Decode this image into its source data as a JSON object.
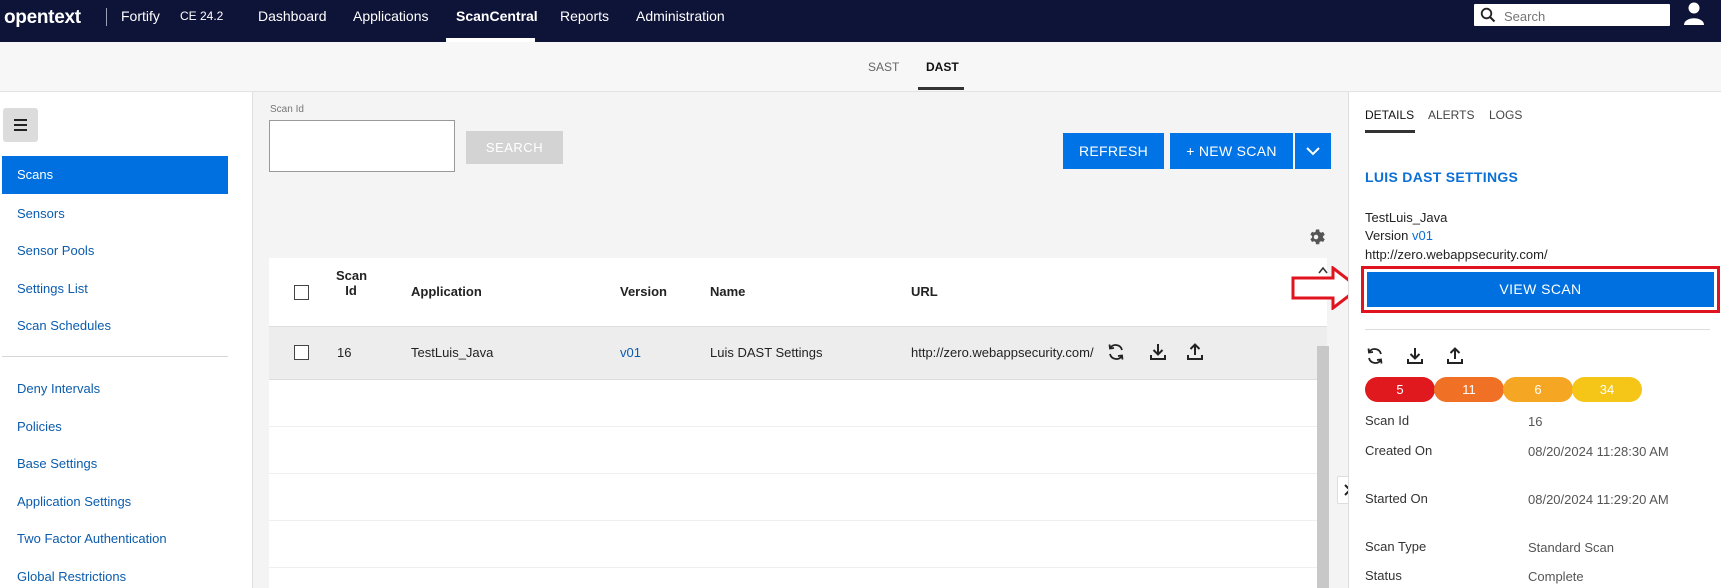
{
  "topbar": {
    "brand": "opentext",
    "product": "Fortify",
    "version": "CE 24.2",
    "nav": [
      "Dashboard",
      "Applications",
      "ScanCentral",
      "Reports",
      "Administration"
    ],
    "active_nav": "ScanCentral",
    "search_placeholder": "Search"
  },
  "subtabs": {
    "items": [
      "SAST",
      "DAST"
    ],
    "active": "DAST"
  },
  "sidebar": {
    "active_item": "Scans",
    "group1": [
      "Sensors",
      "Sensor Pools",
      "Settings List",
      "Scan Schedules"
    ],
    "group2": [
      "Deny Intervals",
      "Policies",
      "Base Settings",
      "Application Settings",
      "Two Factor Authentication",
      "Global Restrictions"
    ]
  },
  "main": {
    "scan_id_label": "Scan Id",
    "search_label": "SEARCH",
    "refresh_label": "REFRESH",
    "new_scan_label": "+ NEW SCAN",
    "columns": {
      "scan_id_line1": "Scan",
      "scan_id_line2": "Id",
      "application": "Application",
      "version": "Version",
      "name": "Name",
      "url": "URL"
    },
    "rows": [
      {
        "scan_id": "16",
        "application": "TestLuis_Java",
        "version": "v01",
        "name": "Luis DAST Settings",
        "url": "http://zero.webappsecurity.com/"
      }
    ]
  },
  "details": {
    "tabs": [
      "DETAILS",
      "ALERTS",
      "LOGS"
    ],
    "active_tab": "DETAILS",
    "title": "LUIS DAST SETTINGS",
    "application": "TestLuis_Java",
    "version_label": "Version",
    "version": "v01",
    "url": "http://zero.webappsecurity.com/",
    "view_scan_label": "VIEW SCAN",
    "severity_counts": [
      {
        "value": "5",
        "color": "#e0191f"
      },
      {
        "value": "11",
        "color": "#f07025"
      },
      {
        "value": "6",
        "color": "#f5a623"
      },
      {
        "value": "34",
        "color": "#f5c518"
      }
    ],
    "properties": [
      {
        "label": "Scan Id",
        "value": "16"
      },
      {
        "label": "Created On",
        "value": "08/20/2024 11:28:30 AM"
      },
      {
        "label": "Started On",
        "value": "08/20/2024 11:29:20 AM"
      },
      {
        "label": "Scan Type",
        "value": "Standard Scan"
      },
      {
        "label": "Status",
        "value": "Complete"
      }
    ]
  },
  "colors": {
    "accent": "#0073e6",
    "topbar": "#0e1338",
    "highlight": "#e0141e"
  }
}
